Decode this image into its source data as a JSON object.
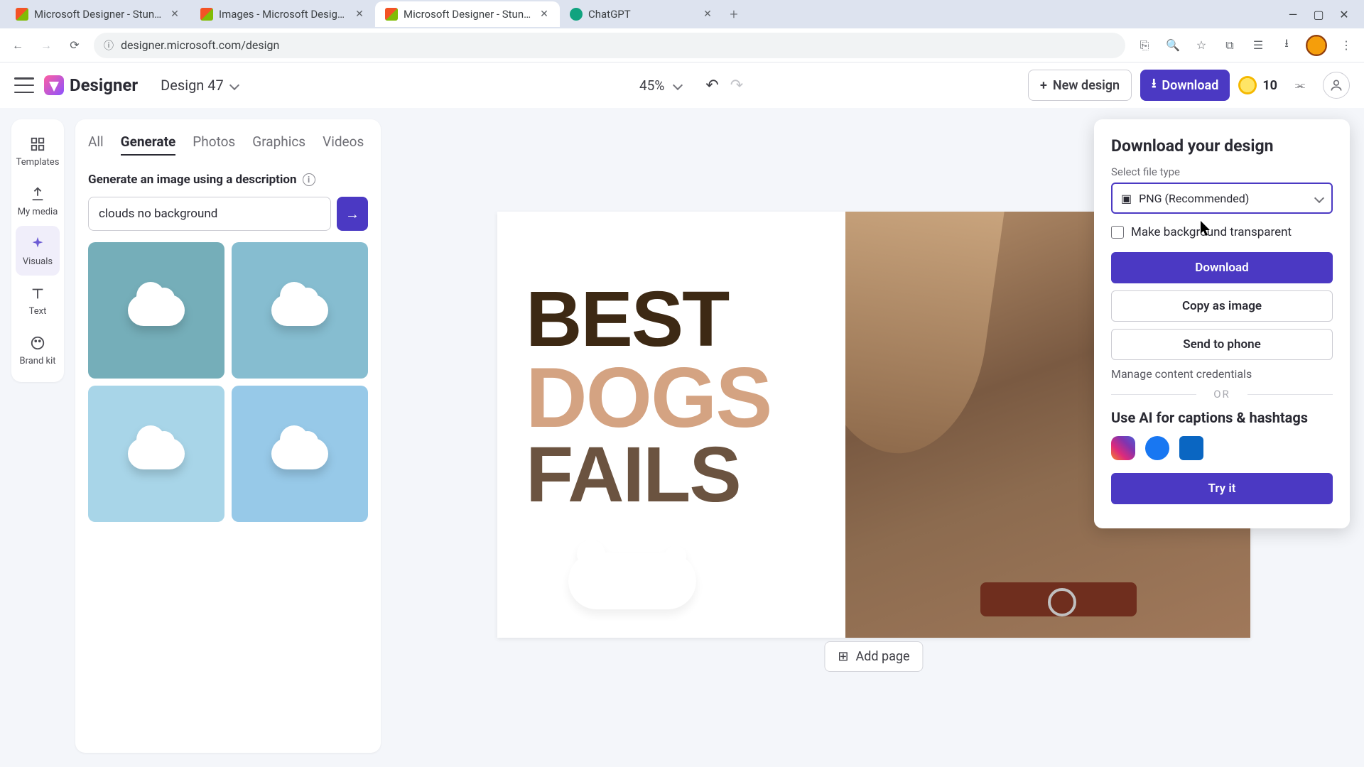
{
  "browser": {
    "tabs": [
      {
        "title": "Microsoft Designer - Stunning",
        "active": false
      },
      {
        "title": "Images - Microsoft Designer",
        "active": false
      },
      {
        "title": "Microsoft Designer - Stunning",
        "active": true
      },
      {
        "title": "ChatGPT",
        "active": false
      }
    ],
    "url": "designer.microsoft.com/design"
  },
  "header": {
    "app_name": "Designer",
    "design_name": "Design 47",
    "zoom": "45%",
    "new_design": "New design",
    "download": "Download",
    "credits": "10"
  },
  "left_rail": {
    "items": [
      "Templates",
      "My media",
      "Visuals",
      "Text",
      "Brand kit"
    ],
    "active_index": 2
  },
  "panel": {
    "tabs": [
      "All",
      "Generate",
      "Photos",
      "Graphics",
      "Videos"
    ],
    "active_tab": 1,
    "generate_heading": "Generate an image using a description",
    "prompt_value": "clouds no background"
  },
  "canvas": {
    "line1": "BEST",
    "line2": "DOGS",
    "line3": "FAILS",
    "add_page": "Add page"
  },
  "popover": {
    "title": "Download your design",
    "select_label": "Select file type",
    "select_value": "PNG (Recommended)",
    "transparent": "Make background transparent",
    "download": "Download",
    "copy": "Copy as image",
    "send": "Send to phone",
    "manage": "Manage content credentials",
    "or": "OR",
    "ai_heading": "Use AI for captions & hashtags",
    "try_it": "Try it"
  }
}
